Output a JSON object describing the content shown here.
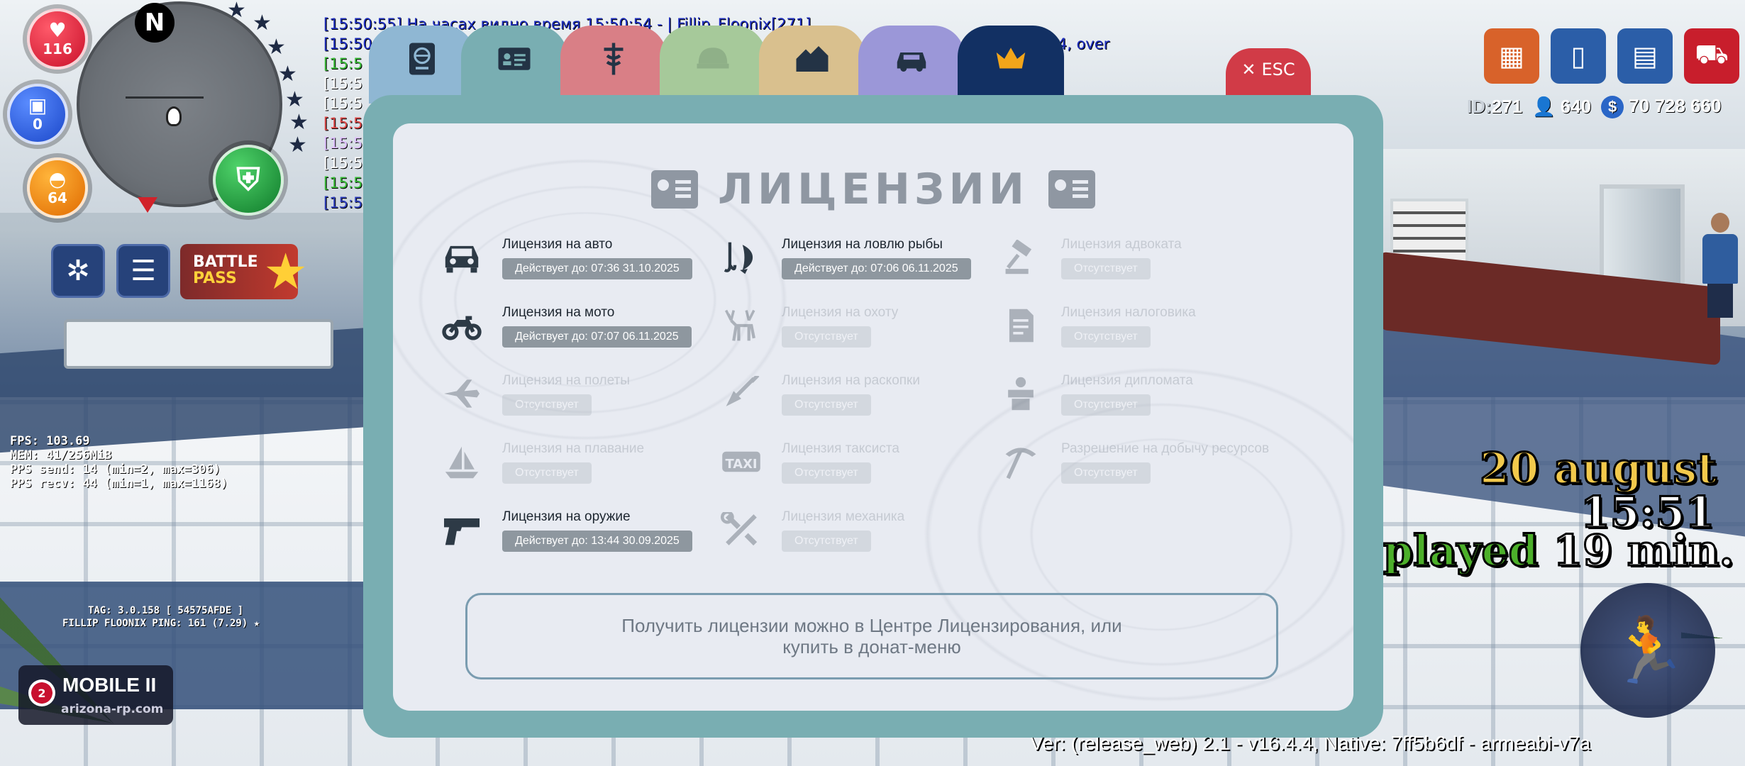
{
  "hud": {
    "north": "N",
    "health": "116",
    "armor": "0",
    "hunger": "64",
    "battle_pass_top": "BATTLE",
    "battle_pass_bottom": "PASS",
    "server_name": "MOBILE II",
    "server_number": "2",
    "server_url": "arizona-rp.com",
    "debug_lines": [
      "FPS: 103.69",
      "MEM: 41/256MiB",
      "PPS send: 14 (min=2, max=306)",
      "PPS recv: 44 (min=1, max=1168)"
    ],
    "tag_line": "TAG: 3.0.158 [ 54575AFDE ]",
    "player_line": "FILLIP FLOONIX   PING: 161 (7.29) ★",
    "player_id_label": "ID:",
    "player_id": "271",
    "online": "640",
    "money": "70 728 660",
    "date": "20 august",
    "time": "15:51",
    "played_label": "played",
    "played_value": "19 min.",
    "version": "Ver: (release_web) 2.1 - v16.4.4, Native: 7ff5b6df - armeabi-v7a"
  },
  "chat": [
    {
      "text": "[15:50:55] На часах видно время 15:50:54 - | Fillip_Floonix[271]",
      "color": "#1f2fbf"
    },
    {
      "text": "[15:50:",
      "color": "#1f2fbf",
      "tail": "0-4, over"
    },
    {
      "text": "[15:5",
      "color": "#3cbf3a"
    },
    {
      "text": "[15:5",
      "color": "#ffffff"
    },
    {
      "text": "[15:5",
      "color": "#ffffff"
    },
    {
      "text": "[15:5",
      "color": "#e04a4a"
    },
    {
      "text": "[15:5",
      "color": "#e0c0ff"
    },
    {
      "text": "[15:5",
      "color": "#ffffff"
    },
    {
      "text": "[15:5",
      "color": "#3cbf3a"
    },
    {
      "text": "[15:5",
      "color": "#2f3fbf"
    }
  ],
  "tabs": [
    {
      "name": "passport",
      "color": "#8fb7d3"
    },
    {
      "name": "licenses",
      "color": "#79aeb2"
    },
    {
      "name": "medical",
      "color": "#d97f86"
    },
    {
      "name": "army",
      "color": "#a6c99a"
    },
    {
      "name": "property",
      "color": "#d9c08e"
    },
    {
      "name": "vehicles",
      "color": "#9b97d8"
    },
    {
      "name": "vip",
      "color": "#123063"
    }
  ],
  "esc_label": "ESC",
  "panel": {
    "title": "ЛИЦЕНЗИИ",
    "notice_line1": "Получить лицензии можно в Центре Лицензирования, или",
    "notice_line2": "купить в донат-меню"
  },
  "licenses": [
    {
      "key": "car",
      "name": "Лицензия на авто",
      "status": "Действует до: 07:36 31.10.2025",
      "active": true,
      "icon": "car-icon"
    },
    {
      "key": "fishing",
      "name": "Лицензия на ловлю рыбы",
      "status": "Действует до: 07:06 06.11.2025",
      "active": true,
      "icon": "fishing-icon"
    },
    {
      "key": "lawyer",
      "name": "Лицензия адвоката",
      "status": "Отсутствует",
      "active": false,
      "icon": "gavel-icon"
    },
    {
      "key": "moto",
      "name": "Лицензия на мото",
      "status": "Действует до: 07:07 06.11.2025",
      "active": true,
      "icon": "motorcycle-icon"
    },
    {
      "key": "hunting",
      "name": "Лицензия на охоту",
      "status": "Отсутствует",
      "active": false,
      "icon": "deer-icon"
    },
    {
      "key": "tax",
      "name": "Лицензия налоговика",
      "status": "Отсутствует",
      "active": false,
      "icon": "document-icon"
    },
    {
      "key": "flights",
      "name": "Лицензия на полеты",
      "status": "Отсутствует",
      "active": false,
      "icon": "plane-icon"
    },
    {
      "key": "digging",
      "name": "Лицензия на раскопки",
      "status": "Отсутствует",
      "active": false,
      "icon": "shovel-icon"
    },
    {
      "key": "diplomat",
      "name": "Лицензия дипломата",
      "status": "Отсутствует",
      "active": false,
      "icon": "speaker-icon"
    },
    {
      "key": "sailing",
      "name": "Лицензия на плавание",
      "status": "Отсутствует",
      "active": false,
      "icon": "boat-icon"
    },
    {
      "key": "taxi",
      "name": "Лицензия таксиста",
      "status": "Отсутствует",
      "active": false,
      "icon": "taxi-icon"
    },
    {
      "key": "mining",
      "name": "Разрешение на добычу ресурсов",
      "status": "Отсутствует",
      "active": false,
      "icon": "pickaxe-icon"
    },
    {
      "key": "weapon",
      "name": "Лицензия на оружие",
      "status": "Действует до: 13:44 30.09.2025",
      "active": true,
      "icon": "pistol-icon"
    },
    {
      "key": "mechanic",
      "name": "Лицензия механика",
      "status": "Отсутствует",
      "active": false,
      "icon": "wrench-icon"
    }
  ]
}
